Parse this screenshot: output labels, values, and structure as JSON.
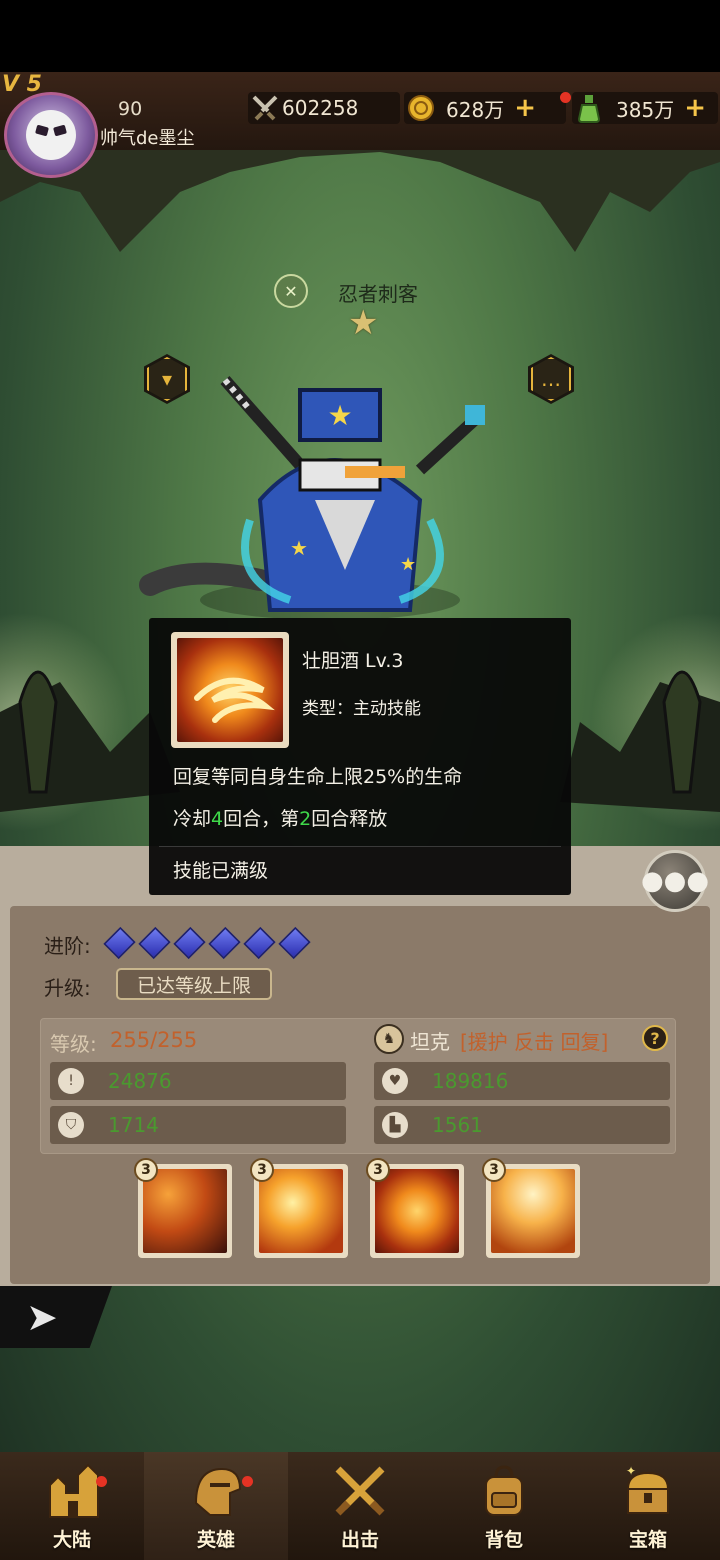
{
  "player": {
    "vip_label": "V 5",
    "level": "90",
    "name": "帅气de墨尘"
  },
  "resources": [
    {
      "icon": "swords-icon",
      "value": "602258",
      "has_plus": false
    },
    {
      "icon": "coin-icon",
      "value": "628万",
      "has_plus": true
    },
    {
      "icon": "potion-icon",
      "value": "385万",
      "has_plus": true
    }
  ],
  "hero": {
    "class_icon": "ninja-class-icon",
    "name": "忍者刺客",
    "stars": "★",
    "left_hex_icon": "armor-icon",
    "right_hex_icon": "dialog-icon"
  },
  "tooltip": {
    "title": "壮胆酒  Lv.3",
    "type": "类型：主动技能",
    "description": "回复等同自身生命上限25%的生命",
    "cooldown_prefix": "冷却",
    "cooldown_turns": "4",
    "cooldown_mid": "回合，第",
    "release_turn": "2",
    "cooldown_suffix": "回合释放",
    "max_text": "技能已满级"
  },
  "panel": {
    "advance_label": "进阶:",
    "advance_gems": 6,
    "upgrade_label": "升级:",
    "upgrade_button": "已达等级上限",
    "level_label": "等级:",
    "level_value": "255/255",
    "role_name": "坦克",
    "role_tags": "[援护 反击 回复]",
    "help": "?",
    "stats": [
      {
        "icon": "attack-icon",
        "value": "24876"
      },
      {
        "icon": "hp-heart-icon",
        "value": "189816"
      },
      {
        "icon": "defense-shield-icon",
        "value": "1714"
      },
      {
        "icon": "speed-boot-icon",
        "value": "1561"
      }
    ],
    "skills": [
      {
        "level": "3",
        "name": "skill-warrior"
      },
      {
        "level": "3",
        "name": "skill-fireball"
      },
      {
        "level": "3",
        "name": "skill-spiral-potion"
      },
      {
        "level": "3",
        "name": "skill-dance"
      }
    ]
  },
  "nav": [
    {
      "label": "大陆",
      "icon": "castle-icon",
      "badge": true,
      "active": false
    },
    {
      "label": "英雄",
      "icon": "helmet-icon",
      "badge": true,
      "active": true
    },
    {
      "label": "出击",
      "icon": "crossed-swords-icon",
      "badge": false,
      "active": false
    },
    {
      "label": "背包",
      "icon": "backpack-icon",
      "badge": false,
      "active": false
    },
    {
      "label": "宝箱",
      "icon": "treasure-chest-icon",
      "badge": false,
      "active": false
    }
  ],
  "colors": {
    "accent_gold": "#e6b53c",
    "tooltip_highlight": "#3fd94a",
    "stat_value": "#4a9a2f",
    "level_value": "#c2612c"
  }
}
